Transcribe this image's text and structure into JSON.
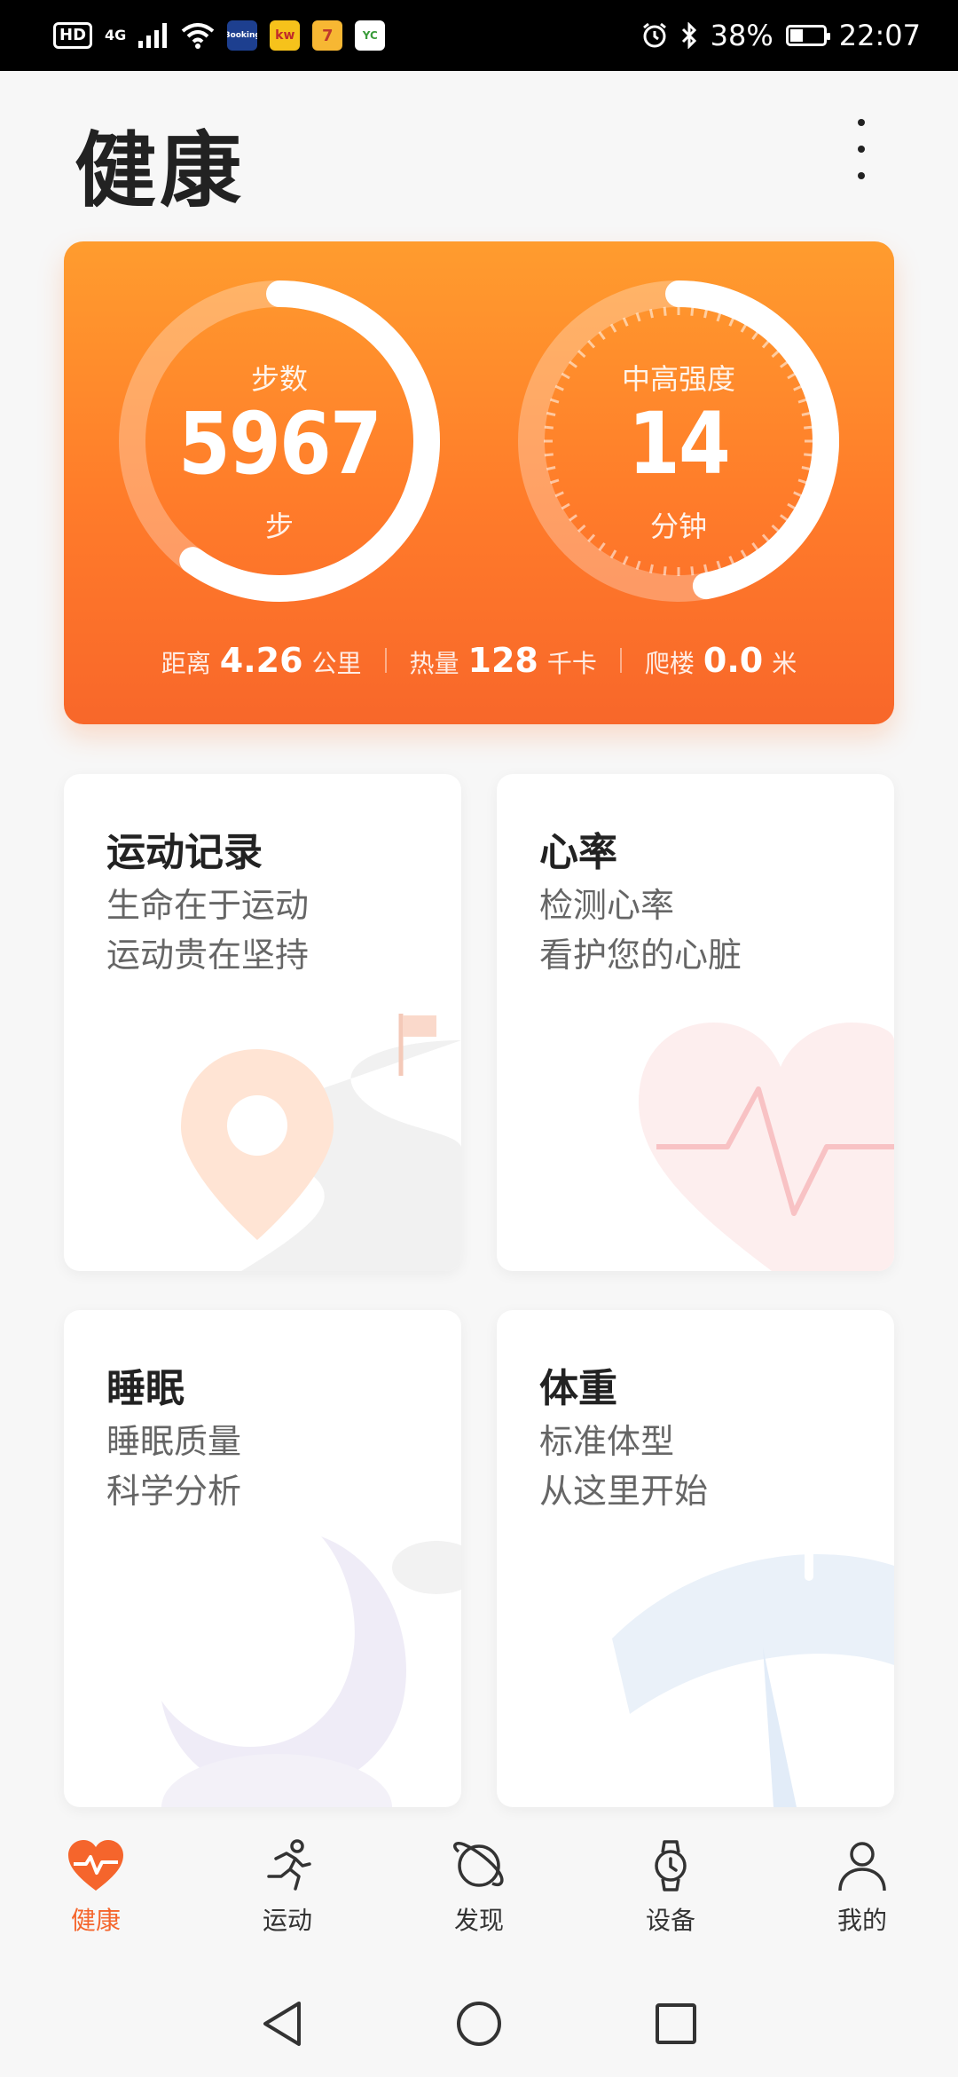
{
  "status_bar": {
    "hd": "HD",
    "network": "4G",
    "apps": [
      "Booking",
      "kw",
      "7",
      "YC"
    ],
    "battery": "38%",
    "time": "22:07"
  },
  "header": {
    "title": "健康"
  },
  "summary": {
    "steps": {
      "label": "步数",
      "value": "5967",
      "unit": "步",
      "progress": 0.6
    },
    "intensity": {
      "label": "中高强度",
      "value": "14",
      "unit": "分钟",
      "progress": 0.47
    },
    "stats": [
      {
        "label": "距离",
        "value": "4.26",
        "unit": "公里"
      },
      {
        "label": "热量",
        "value": "128",
        "unit": "千卡"
      },
      {
        "label": "爬楼",
        "value": "0.0",
        "unit": "米"
      }
    ],
    "colors": {
      "gradient_top": "#ff9c2e",
      "gradient_bottom": "#f8672a"
    }
  },
  "cards": [
    {
      "title": "运动记录",
      "line1": "生命在于运动",
      "line2": "运动贵在坚持",
      "icon": "map-pin-icon"
    },
    {
      "title": "心率",
      "line1": "检测心率",
      "line2": "看护您的心脏",
      "icon": "heart-icon"
    },
    {
      "title": "睡眠",
      "line1": "睡眠质量",
      "line2": "科学分析",
      "icon": "moon-icon"
    },
    {
      "title": "体重",
      "line1": "标准体型",
      "line2": "从这里开始",
      "icon": "scale-gauge-icon"
    }
  ],
  "nav": {
    "items": [
      {
        "label": "健康",
        "icon": "heart-pulse-icon",
        "active": true
      },
      {
        "label": "运动",
        "icon": "running-icon"
      },
      {
        "label": "发现",
        "icon": "planet-icon"
      },
      {
        "label": "设备",
        "icon": "watch-icon"
      },
      {
        "label": "我的",
        "icon": "person-icon"
      }
    ],
    "accent": "#f5652c"
  }
}
